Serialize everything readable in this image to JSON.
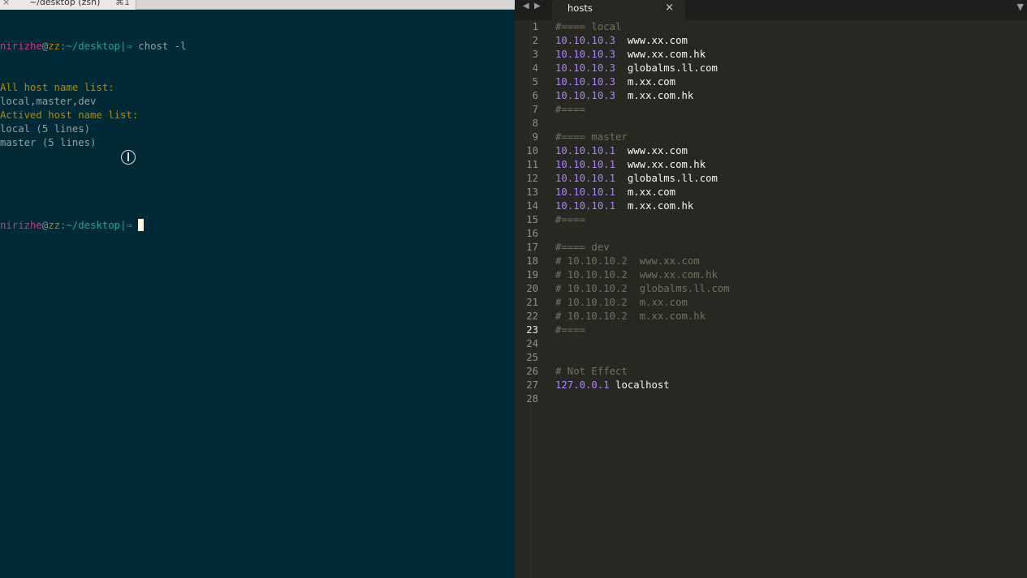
{
  "terminal": {
    "tab": {
      "close": "×",
      "title": "~/desktop (zsh)",
      "shortcut": "⌘1"
    },
    "prompt": {
      "user": "nirizhe",
      "at": "@",
      "host": "zz",
      "path": ":~/desktop|⇒ "
    },
    "command": "chost -l",
    "output": [
      {
        "text": "All host name list:",
        "style": "yellow"
      },
      {
        "text": "local,master,dev",
        "style": "text"
      },
      {
        "text": "Actived host name list:",
        "style": "yellow"
      },
      {
        "text": "local (5 lines)",
        "style": "text"
      },
      {
        "text": "master (5 lines)",
        "style": "text"
      }
    ]
  },
  "editor": {
    "nav_back": "◀",
    "nav_forward": "▶",
    "tab_title": "hosts",
    "tab_close": "×",
    "menu_icon": "▼",
    "active_line": 23,
    "lines": [
      {
        "n": "1",
        "kind": "comment",
        "text": "#==== local"
      },
      {
        "n": "2",
        "kind": "entry",
        "ip": "10.10.10.3",
        "host": "www.xx.com"
      },
      {
        "n": "3",
        "kind": "entry",
        "ip": "10.10.10.3",
        "host": "www.xx.com.hk"
      },
      {
        "n": "4",
        "kind": "entry",
        "ip": "10.10.10.3",
        "host": "globalms.ll.com"
      },
      {
        "n": "5",
        "kind": "entry",
        "ip": "10.10.10.3",
        "host": "m.xx.com"
      },
      {
        "n": "6",
        "kind": "entry",
        "ip": "10.10.10.3",
        "host": "m.xx.com.hk"
      },
      {
        "n": "7",
        "kind": "comment",
        "text": "#===="
      },
      {
        "n": "8",
        "kind": "blank",
        "text": ""
      },
      {
        "n": "9",
        "kind": "comment",
        "text": "#==== master"
      },
      {
        "n": "10",
        "kind": "entry",
        "ip": "10.10.10.1",
        "host": "www.xx.com"
      },
      {
        "n": "11",
        "kind": "entry",
        "ip": "10.10.10.1",
        "host": "www.xx.com.hk"
      },
      {
        "n": "12",
        "kind": "entry",
        "ip": "10.10.10.1",
        "host": "globalms.ll.com"
      },
      {
        "n": "13",
        "kind": "entry",
        "ip": "10.10.10.1",
        "host": "m.xx.com"
      },
      {
        "n": "14",
        "kind": "entry",
        "ip": "10.10.10.1",
        "host": "m.xx.com.hk"
      },
      {
        "n": "15",
        "kind": "comment",
        "text": "#===="
      },
      {
        "n": "16",
        "kind": "blank",
        "text": ""
      },
      {
        "n": "17",
        "kind": "comment",
        "text": "#==== dev"
      },
      {
        "n": "18",
        "kind": "comment",
        "text": "# 10.10.10.2  www.xx.com"
      },
      {
        "n": "19",
        "kind": "comment",
        "text": "# 10.10.10.2  www.xx.com.hk"
      },
      {
        "n": "20",
        "kind": "comment",
        "text": "# 10.10.10.2  globalms.ll.com"
      },
      {
        "n": "21",
        "kind": "comment",
        "text": "# 10.10.10.2  m.xx.com"
      },
      {
        "n": "22",
        "kind": "comment",
        "text": "# 10.10.10.2  m.xx.com.hk"
      },
      {
        "n": "23",
        "kind": "comment",
        "text": "#===="
      },
      {
        "n": "24",
        "kind": "blank",
        "text": ""
      },
      {
        "n": "25",
        "kind": "blank",
        "text": ""
      },
      {
        "n": "26",
        "kind": "comment",
        "text": "# Not Effect"
      },
      {
        "n": "27",
        "kind": "localhost",
        "ip": "127.0.0.1",
        "host": "localhost"
      },
      {
        "n": "28",
        "kind": "blank",
        "text": ""
      }
    ]
  }
}
